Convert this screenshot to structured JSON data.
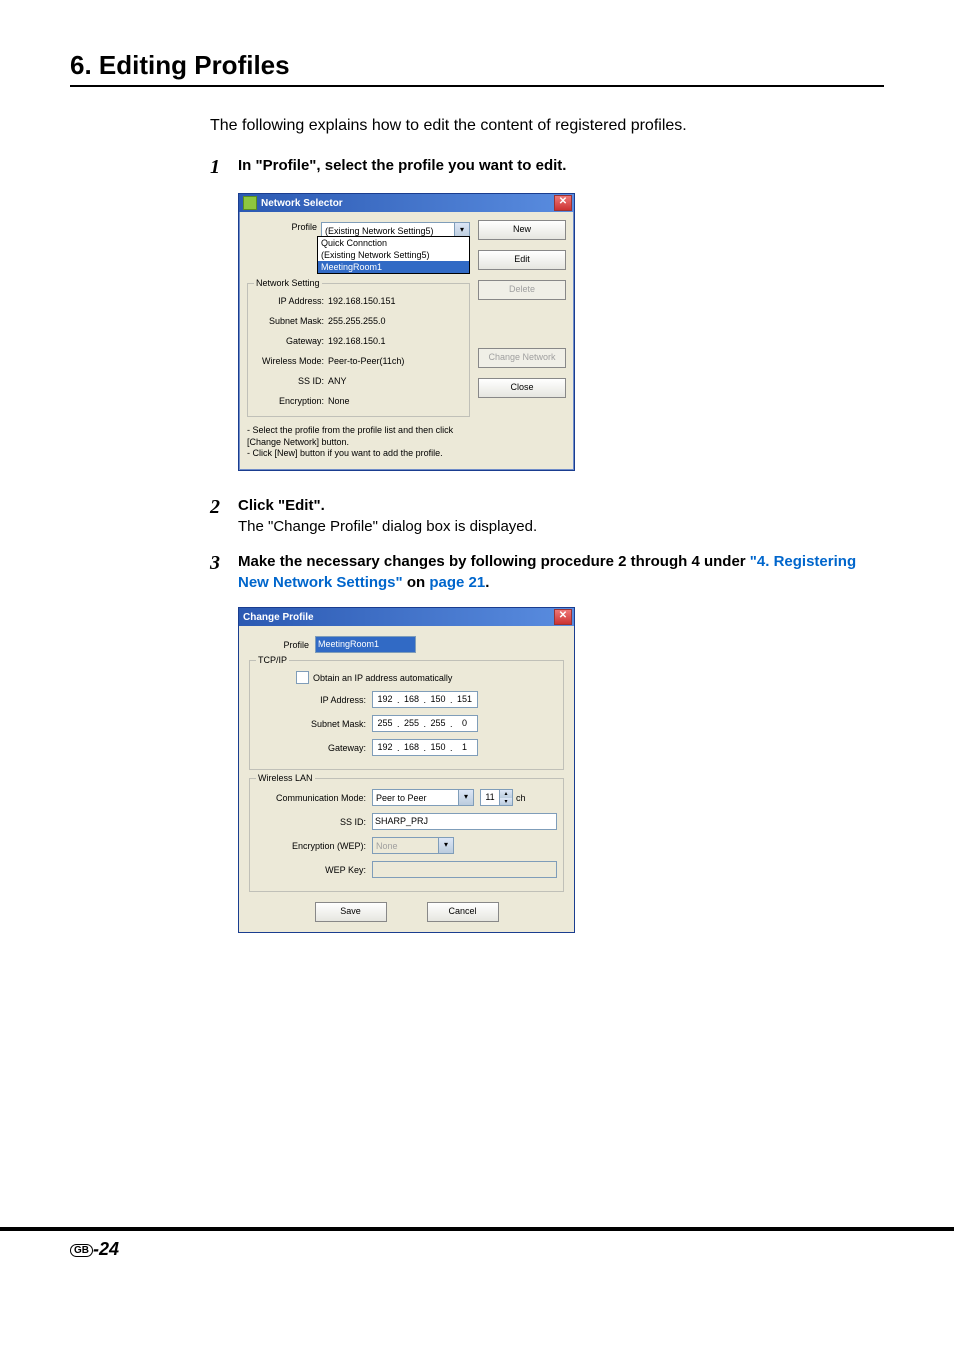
{
  "heading": "6. Editing Profiles",
  "intro": "The following explains how to edit the content of registered profiles.",
  "steps": {
    "s1": {
      "num": "1",
      "title": "In \"Profile\", select the profile you want to edit."
    },
    "s2": {
      "num": "2",
      "title": "Click \"Edit\".",
      "sub": "The \"Change Profile\" dialog box is displayed."
    },
    "s3": {
      "num": "3",
      "lead": "Make the necessary changes by following procedure 2 through 4 under ",
      "link1": "\"4. Registering New Network Settings\"",
      "mid": " on ",
      "link2": "page 21",
      "end": "."
    }
  },
  "ns": {
    "title": "Network Selector",
    "close": "✕",
    "profileLabel": "Profile",
    "profileValue": "(Existing Network Setting5)",
    "dropdown": {
      "opt1": "Quick Connction",
      "opt2": "(Existing Network Setting5)",
      "opt3": "MeetingRoom1"
    },
    "group": "Network Setting",
    "ipLabel": "IP Address:",
    "ipValue": "192.168.150.151",
    "smLabel": "Subnet Mask:",
    "smValue": "255.255.255.0",
    "gwLabel": "Gateway:",
    "gwValue": "192.168.150.1",
    "wmLabel": "Wireless Mode:",
    "wmValue": "Peer-to-Peer(11ch)",
    "ssLabel": "SS ID:",
    "ssValue": "ANY",
    "encLabel": "Encryption:",
    "encValue": "None",
    "hint1": "- Select the profile from the profile list and then click [Change Network] button.",
    "hint2": "- Click [New] button if you want to add the profile.",
    "btnNew": "New",
    "btnEdit": "Edit",
    "btnDelete": "Delete",
    "btnChange": "Change Network",
    "btnClose": "Close"
  },
  "cp": {
    "title": "Change Profile",
    "close": "✕",
    "profileLabel": "Profile",
    "profileValue": "MeetingRoom1",
    "tcpGroup": "TCP/IP",
    "obtain": "Obtain an IP address automatically",
    "ipLabel": "IP Address:",
    "ip": {
      "a": "192",
      "b": "168",
      "c": "150",
      "d": "151"
    },
    "smLabel": "Subnet Mask:",
    "sm": {
      "a": "255",
      "b": "255",
      "c": "255",
      "d": "0"
    },
    "gwLabel": "Gateway:",
    "gw": {
      "a": "192",
      "b": "168",
      "c": "150",
      "d": "1"
    },
    "wlanGroup": "Wireless LAN",
    "cmLabel": "Communication Mode:",
    "cmValue": "Peer to Peer",
    "chValue": "11",
    "chUnit": "ch",
    "ssidLabel": "SS ID:",
    "ssidValue": "SHARP_PRJ",
    "wepLabel": "Encryption (WEP):",
    "wepValue": "None",
    "keyLabel": "WEP Key:",
    "keyValue": "",
    "btnSave": "Save",
    "btnCancel": "Cancel"
  },
  "footer": {
    "gb": "GB",
    "page": "-24"
  }
}
